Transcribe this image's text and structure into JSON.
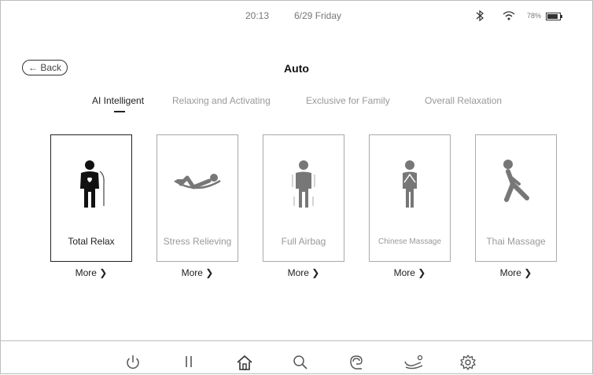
{
  "status": {
    "time": "20:13",
    "date": "6/29 Friday",
    "battery": "78%"
  },
  "header": {
    "back_label": "← Back",
    "title": "Auto"
  },
  "tabs": [
    {
      "label": "AI Intelligent"
    },
    {
      "label": "Relaxing and Activating"
    },
    {
      "label": "Exclusive for Family"
    },
    {
      "label": "Overall Relaxation"
    }
  ],
  "programs": [
    {
      "label": "Total Relax",
      "more": "More ❯",
      "icon": "body-heart-icon"
    },
    {
      "label": "Stress Relieving",
      "more": "More ❯",
      "icon": "reclining-person-icon"
    },
    {
      "label": "Full Airbag",
      "more": "More ❯",
      "icon": "standing-airbag-icon"
    },
    {
      "label": "Chinese Massage",
      "more": "More ❯",
      "icon": "namaste-person-icon"
    },
    {
      "label": "Thai Massage",
      "more": "More ❯",
      "icon": "lunge-stretch-icon"
    }
  ],
  "nav": [
    "power-icon",
    "pause-icon",
    "home-icon",
    "search-icon",
    "hand-massage-icon",
    "recline-icon",
    "settings-icon"
  ]
}
